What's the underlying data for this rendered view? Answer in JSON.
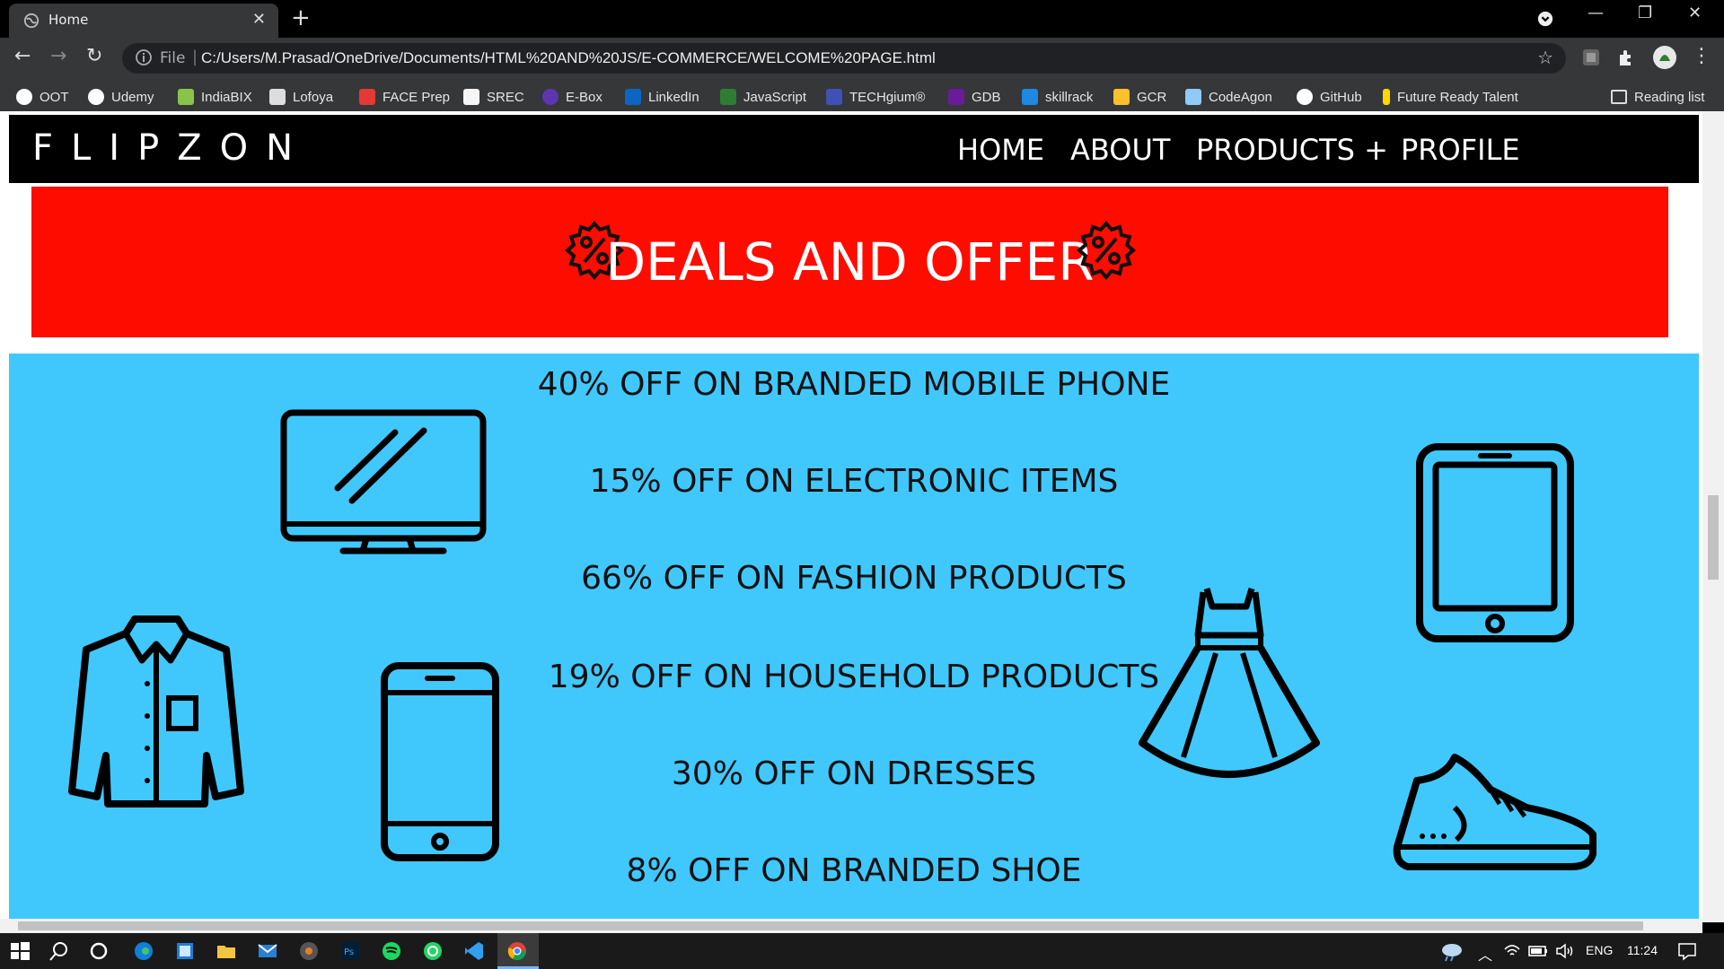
{
  "browser": {
    "tab_title": "Home",
    "tab_close": "✕",
    "new_tab": "+",
    "minimize": "—",
    "restore": "❐",
    "close": "✕",
    "address_prefix": "File",
    "url": "C:/Users/M.Prasad/OneDrive/Documents/HTML%20AND%20JS/E-COMMERCE/WELCOME%20PAGE.html"
  },
  "bookmarks": [
    {
      "label": "OOT",
      "color": "#ffffff"
    },
    {
      "label": "Udemy",
      "color": "#ffffff"
    },
    {
      "label": "IndiaBIX",
      "color": "#8bc34a"
    },
    {
      "label": "Lofoya",
      "color": "#dddddd"
    },
    {
      "label": "FACE Prep",
      "color": "#e53935"
    },
    {
      "label": "SREC",
      "color": "#f5f5f5"
    },
    {
      "label": "E-Box",
      "color": "#5e35b1"
    },
    {
      "label": "LinkedIn",
      "color": "#0a66c2"
    },
    {
      "label": "JavaScript",
      "color": "#2e7d32"
    },
    {
      "label": "TECHgium®",
      "color": "#3f51b5"
    },
    {
      "label": "GDB",
      "color": "#6a1b9a"
    },
    {
      "label": "skillrack",
      "color": "#1e88e5"
    },
    {
      "label": "GCR",
      "color": "#fbc02d"
    },
    {
      "label": "CodeAgon",
      "color": "#90caf9"
    },
    {
      "label": "GitHub",
      "color": "#ffffff"
    },
    {
      "label": "Future Ready Talent",
      "color": "#ffd600"
    }
  ],
  "reading_list": "Reading list",
  "site": {
    "brand": "FLIPZON",
    "nav": [
      "HOME",
      "ABOUT",
      "PRODUCTS +",
      "PROFILE"
    ],
    "banner_title": "DEALS AND OFFER",
    "offers": [
      "40% OFF ON BRANDED MOBILE PHONE",
      "15% OFF ON ELECTRONIC ITEMS",
      "66% OFF ON FASHION PRODUCTS",
      "19% OFF ON HOUSEHOLD PRODUCTS",
      "30% OFF ON DRESSES",
      "8% OFF ON BRANDED SHOE"
    ],
    "colors": {
      "banner": "#ff0c00",
      "offers_bg": "#40c8fd",
      "nav_bg": "#000000"
    }
  },
  "taskbar": {
    "language": "ENG",
    "time": "11:24"
  }
}
